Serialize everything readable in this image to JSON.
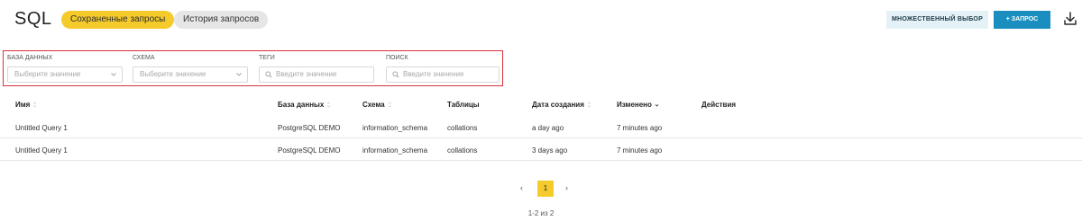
{
  "header": {
    "title": "SQL",
    "tabs": [
      {
        "label": "Сохраненные запросы",
        "active": true
      },
      {
        "label": "История запросов",
        "active": false
      }
    ],
    "multi_select_label": "МНОЖЕСТВЕННЫЙ ВЫБОР",
    "add_query_label": "+ ЗАПРОС",
    "download_icon": "download-icon"
  },
  "filters": {
    "database": {
      "label": "БАЗА ДАННЫХ",
      "placeholder": "Выберите значение"
    },
    "schema": {
      "label": "СХЕМА",
      "placeholder": "Выберите значение"
    },
    "tags": {
      "label": "ТЕГИ",
      "placeholder": "Введите значение"
    },
    "search": {
      "label": "ПОИСК",
      "placeholder": "Введите значение"
    }
  },
  "table": {
    "columns": [
      "Имя",
      "База данных",
      "Схема",
      "Таблицы",
      "Дата создания",
      "Изменено",
      "Действия"
    ],
    "rows": [
      [
        "Untitled Query 1",
        "PostgreSQL DEMO",
        "information_schema",
        "collations",
        "a day ago",
        "7 minutes ago",
        ""
      ],
      [
        "Untitled Query 1",
        "PostgreSQL DEMO",
        "information_schema",
        "collations",
        "3 days ago",
        "7 minutes ago",
        ""
      ]
    ]
  },
  "pagination": {
    "prev": "‹",
    "current": "1",
    "next": "›",
    "summary": "1-2 из 2"
  },
  "colors": {
    "accent_yellow": "#f5cb2c",
    "primary_blue": "#1a8fbf",
    "filter_highlight": "#d9313b"
  }
}
